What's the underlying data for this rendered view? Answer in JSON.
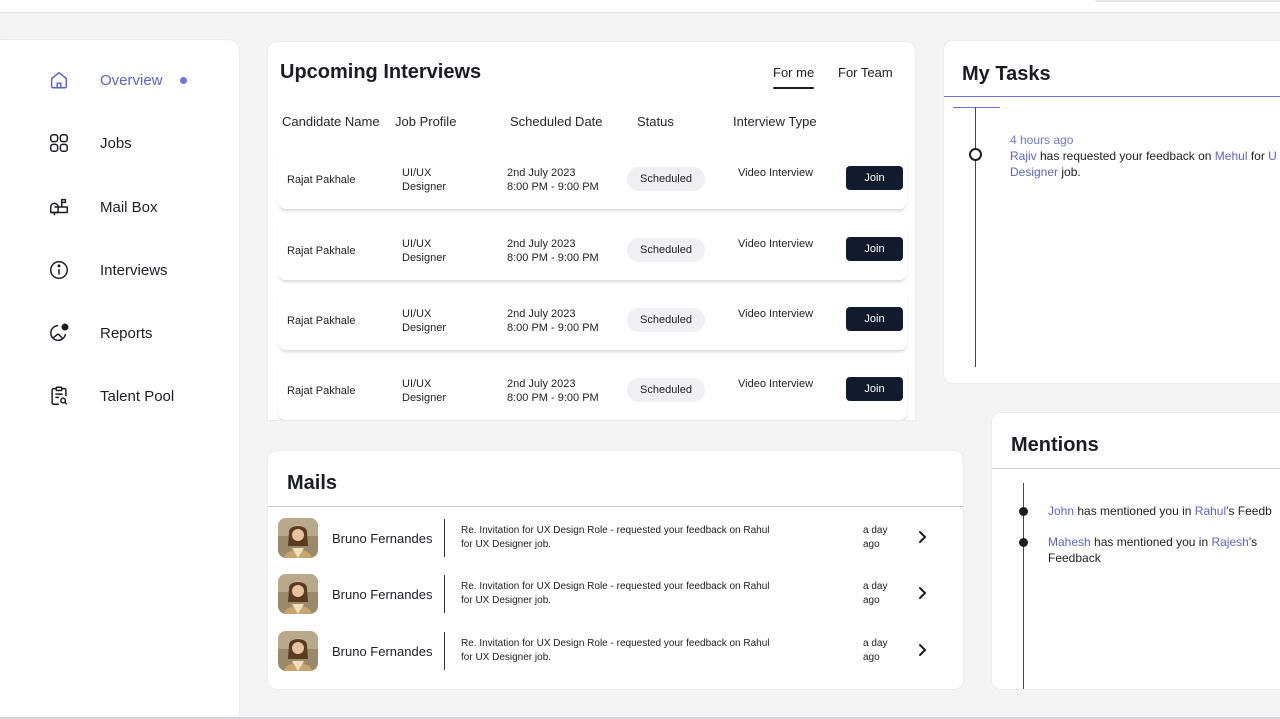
{
  "sidebar": {
    "items": [
      {
        "label": "Overview",
        "icon": "home-icon",
        "active": true
      },
      {
        "label": "Jobs",
        "icon": "grid-icon"
      },
      {
        "label": "Mail Box",
        "icon": "mailbox-icon"
      },
      {
        "label": "Interviews",
        "icon": "info-icon"
      },
      {
        "label": "Reports",
        "icon": "reports-icon"
      },
      {
        "label": "Talent Pool",
        "icon": "clipboard-search-icon"
      }
    ]
  },
  "interviews": {
    "title": "Upcoming Interviews",
    "tabs": [
      "For me",
      "For Team"
    ],
    "columns": [
      "Candidate Name",
      "Job Profile",
      "Scheduled Date",
      "Status",
      "Interview Type"
    ],
    "rows": [
      {
        "name": "Rajat Pakhale",
        "profile": [
          "UI/UX",
          "Designer"
        ],
        "date": "2nd July 2023",
        "time": "8:00 PM - 9:00 PM",
        "status": "Scheduled",
        "type": "Video Interview",
        "action": "Join"
      },
      {
        "name": "Rajat Pakhale",
        "profile": [
          "UI/UX",
          "Designer"
        ],
        "date": "2nd July 2023",
        "time": "8:00 PM - 9:00 PM",
        "status": "Scheduled",
        "type": "Video Interview",
        "action": "Join"
      },
      {
        "name": "Rajat Pakhale",
        "profile": [
          "UI/UX",
          "Designer"
        ],
        "date": "2nd July 2023",
        "time": "8:00 PM - 9:00 PM",
        "status": "Scheduled",
        "type": "Video Interview",
        "action": "Join"
      },
      {
        "name": "Rajat Pakhale",
        "profile": [
          "UI/UX",
          "Designer"
        ],
        "date": "2nd July 2023",
        "time": "8:00 PM - 9:00 PM",
        "status": "Scheduled",
        "type": "Video Interview",
        "action": "Join"
      }
    ]
  },
  "tasks": {
    "title": "My Tasks",
    "items": [
      {
        "time": "4 hours ago",
        "actor": "Rajiv",
        "text1": " has requested your feedback on ",
        "target": "Mehul",
        "text2": " for ",
        "job_a": "U",
        "job_b": "Designer",
        "text3": " job."
      }
    ]
  },
  "mails": {
    "title": "Mails",
    "items": [
      {
        "sender": "Bruno Fernandes",
        "subject": "Re. Invitation for UX Design Role - requested your feedback on Rahul for UX Designer job.",
        "time": "a day ago"
      },
      {
        "sender": "Bruno Fernandes",
        "subject": "Re. Invitation for UX Design Role - requested your feedback on Rahul for UX Designer job.",
        "time": "a day ago"
      },
      {
        "sender": "Bruno Fernandes",
        "subject": "Re. Invitation for UX Design Role - requested your feedback on Rahul for UX Designer job.",
        "time": "a day ago"
      }
    ]
  },
  "mentions": {
    "title": "Mentions",
    "items": [
      {
        "who": "John",
        "text": " has mentioned you in ",
        "owner": "Rahul",
        "suffix": "'s Feedb"
      },
      {
        "who": "Mahesh",
        "text": " has mentioned you in ",
        "owner": "Rajesh",
        "suffix": "'s",
        "line2": "Feedback"
      }
    ]
  },
  "colors": {
    "accent": "#6d74e4",
    "button_dark": "#121a2e",
    "badge_bg": "#f0f0f2"
  }
}
